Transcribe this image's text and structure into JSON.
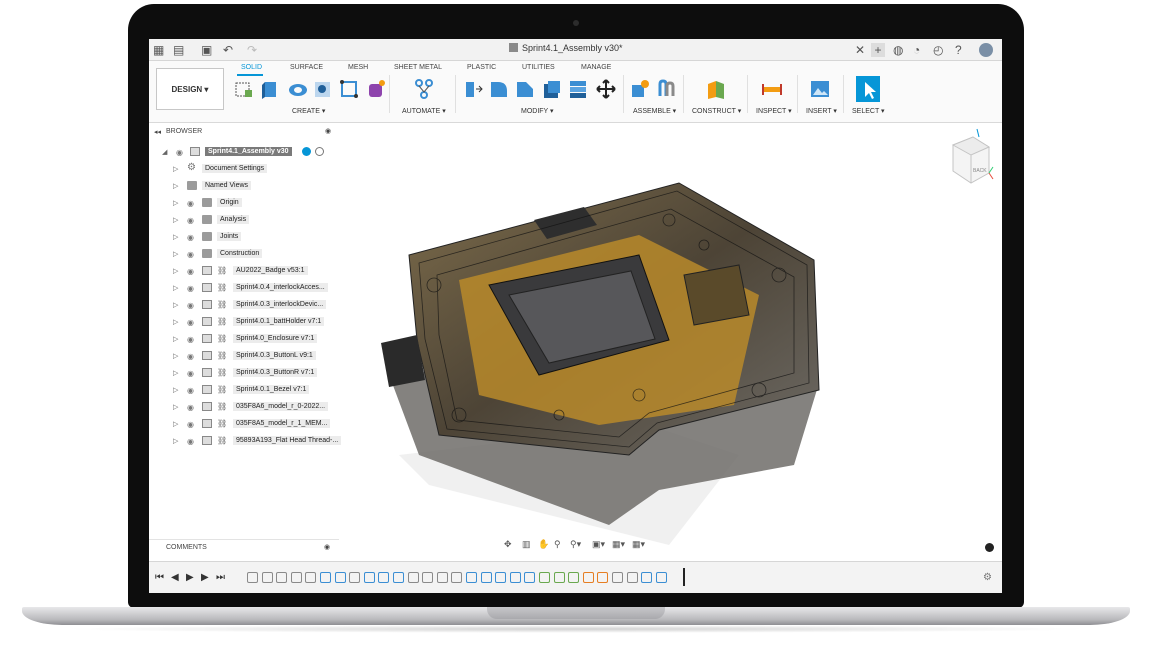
{
  "app": {
    "document_title": "Sprint4.1_Assembly v30*",
    "workspace_button": "DESIGN ▾"
  },
  "toolbar": {
    "tabs": [
      "SOLID",
      "SURFACE",
      "MESH",
      "SHEET METAL",
      "PLASTIC",
      "UTILITIES",
      "MANAGE"
    ],
    "active_tab": "SOLID",
    "groups": [
      "CREATE ▾",
      "AUTOMATE ▾",
      "MODIFY ▾",
      "ASSEMBLE ▾",
      "CONSTRUCT ▾",
      "INSPECT ▾",
      "INSERT ▾",
      "SELECT ▾"
    ]
  },
  "browser": {
    "title": "BROWSER",
    "root": "Sprint4.1_Assembly v30",
    "items": [
      {
        "label": "Document Settings",
        "icon": "gear-icon"
      },
      {
        "label": "Named Views",
        "icon": "folder-icon"
      },
      {
        "label": "Origin",
        "icon": "folder-icon"
      },
      {
        "label": "Analysis",
        "icon": "folder-icon"
      },
      {
        "label": "Joints",
        "icon": "folder-icon"
      },
      {
        "label": "Construction",
        "icon": "folder-icon"
      },
      {
        "label": "AU2022_Badge v53:1",
        "icon": "component-icon"
      },
      {
        "label": "Sprint4.0.4_interlockAcces...",
        "icon": "component-icon"
      },
      {
        "label": "Sprint4.0.3_interlockDevic...",
        "icon": "component-icon"
      },
      {
        "label": "Sprint4.0.1_battHolder v7:1",
        "icon": "component-icon"
      },
      {
        "label": "Sprint4.0_Enclosure v7:1",
        "icon": "component-icon"
      },
      {
        "label": "Sprint4.0.3_ButtonL v9:1",
        "icon": "component-icon"
      },
      {
        "label": "Sprint4.0.3_ButtonR v7:1",
        "icon": "component-icon"
      },
      {
        "label": "Sprint4.0.1_Bezel v7:1",
        "icon": "component-icon"
      },
      {
        "label": "035F8A6_model_r_0-2022...",
        "icon": "component-icon"
      },
      {
        "label": "035F8A5_model_r_1_MEM...",
        "icon": "component-icon"
      },
      {
        "label": "95893A193_Flat Head Thread-...",
        "icon": "component-icon"
      }
    ]
  },
  "comments": {
    "title": "COMMENTS"
  },
  "viewcube": {
    "face_label": "BACK"
  },
  "colors": {
    "accent": "#0696d7",
    "root_label_bg": "#7a7a7a"
  }
}
